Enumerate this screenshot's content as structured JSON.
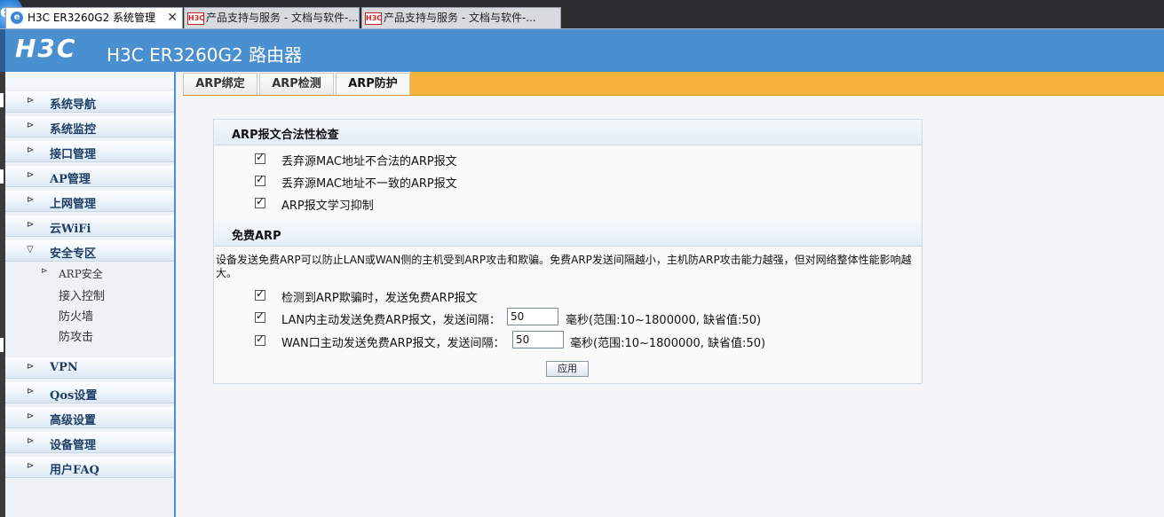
{
  "browser": {
    "tabs": [
      {
        "title": "H3C ER3260G2 系统管理",
        "close": "✕",
        "active": true
      },
      {
        "title": "产品支持与服务 - 文档与软件-...",
        "active": false
      },
      {
        "title": "产品支持与服务 - 文档与软件-...",
        "active": false
      }
    ],
    "favicon_h3c": "H3C"
  },
  "header": {
    "logo": "H3C",
    "title": "H3C ER3260G2 路由器"
  },
  "sidebar": {
    "items": [
      {
        "label": "系统导航"
      },
      {
        "label": "系统监控"
      },
      {
        "label": "接口管理"
      },
      {
        "label": "AP管理"
      },
      {
        "label": "上网管理"
      },
      {
        "label": "云WiFi"
      },
      {
        "label": "安全专区",
        "expanded": true
      },
      {
        "label": "VPN"
      },
      {
        "label": "Qos设置"
      },
      {
        "label": "高级设置"
      },
      {
        "label": "设备管理"
      },
      {
        "label": "用户FAQ"
      }
    ],
    "subitems": [
      {
        "label": "ARP安全",
        "active": true
      },
      {
        "label": "接入控制"
      },
      {
        "label": "防火墙"
      },
      {
        "label": "防攻击"
      }
    ]
  },
  "content": {
    "tabs": [
      {
        "label": "ARP绑定"
      },
      {
        "label": "ARP检测"
      },
      {
        "label": "ARP防护",
        "active": true
      }
    ],
    "legality": {
      "heading": "ARP报文合法性检查",
      "options": [
        {
          "label": "丢弃源MAC地址不合法的ARP报文",
          "checked": true
        },
        {
          "label": "丢弃源MAC地址不一致的ARP报文",
          "checked": true
        },
        {
          "label": "ARP报文学习抑制",
          "checked": true
        }
      ]
    },
    "gratuitous": {
      "heading": "免费ARP",
      "description": "设备发送免费ARP可以防止LAN或WAN侧的主机受到ARP攻击和欺骗。免费ARP发送间隔越小，主机防ARP攻击能力越强，但对网络整体性能影响越大。",
      "detect_option": {
        "label": "检测到ARP欺骗时，发送免费ARP报文",
        "checked": true
      },
      "lan_option": {
        "label": "LAN内主动发送免费ARP报文，发送间隔：",
        "checked": true,
        "value": "50",
        "unit": "毫秒(范围:10~1800000, 缺省值:50)"
      },
      "wan_option": {
        "label": "WAN口主动发送免费ARP报文，发送间隔：",
        "checked": true,
        "value": "50",
        "unit": "毫秒(范围:10~1800000, 缺省值:50)"
      }
    },
    "apply_label": "应用"
  },
  "colors": {
    "header_blue": "#4a8fd0",
    "tab_orange": "#f6b33c",
    "nav_text": "#1f3e66"
  }
}
